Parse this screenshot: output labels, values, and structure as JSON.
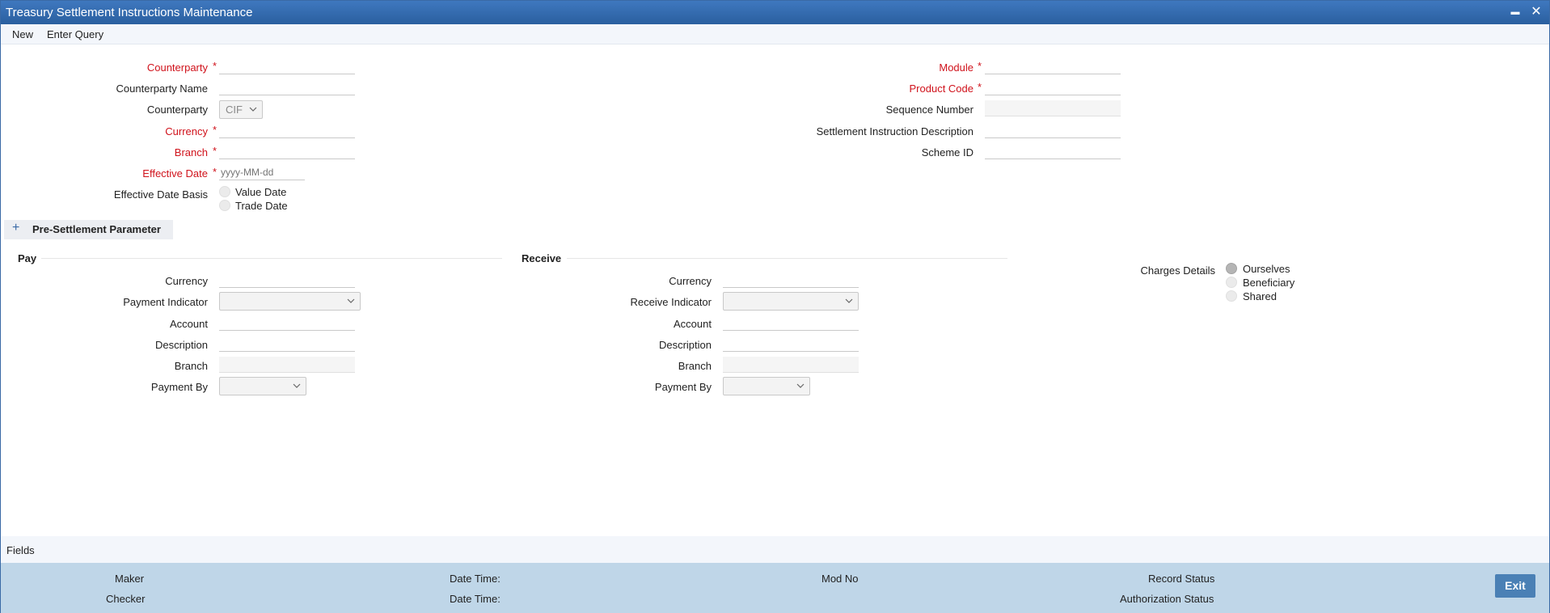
{
  "window": {
    "title": "Treasury Settlement Instructions Maintenance",
    "minimize_glyph": "▬",
    "close_glyph": "✕"
  },
  "menu": {
    "new": "New",
    "enter_query": "Enter Query"
  },
  "header_left": {
    "counterparty": "Counterparty",
    "counterparty_name": "Counterparty Name",
    "counterparty_type": "Counterparty",
    "counterparty_type_value": "CIF",
    "currency": "Currency",
    "branch": "Branch",
    "effective_date": "Effective Date",
    "effective_date_placeholder": "yyyy-MM-dd",
    "effective_date_basis": "Effective Date Basis",
    "value_date": "Value Date",
    "trade_date": "Trade Date"
  },
  "header_right": {
    "module": "Module",
    "product_code": "Product Code",
    "sequence_number": "Sequence Number",
    "settlement_instruction_description": "Settlement Instruction Description",
    "scheme_id": "Scheme ID"
  },
  "required_mark": "*",
  "section": {
    "plus": "+",
    "title": "Pre-Settlement Parameter"
  },
  "pay": {
    "title": "Pay",
    "currency": "Currency",
    "payment_indicator": "Payment Indicator",
    "account": "Account",
    "description": "Description",
    "branch": "Branch",
    "payment_by": "Payment By"
  },
  "receive": {
    "title": "Receive",
    "currency": "Currency",
    "receive_indicator": "Receive Indicator",
    "account": "Account",
    "description": "Description",
    "branch": "Branch",
    "payment_by": "Payment By"
  },
  "charges": {
    "label": "Charges Details",
    "options": [
      "Ourselves",
      "Beneficiary",
      "Shared"
    ],
    "selected": "Ourselves"
  },
  "fields_bar": {
    "label": "Fields"
  },
  "footer": {
    "maker": "Maker",
    "checker": "Checker",
    "date_time_1": "Date Time:",
    "date_time_2": "Date Time:",
    "mod_no": "Mod No",
    "record_status": "Record Status",
    "authorization_status": "Authorization Status",
    "exit": "Exit"
  },
  "colors": {
    "titlebar": "#2f67ab",
    "required": "#d0121b",
    "footer": "#bfd6e8",
    "exit_button": "#4a80b5"
  }
}
